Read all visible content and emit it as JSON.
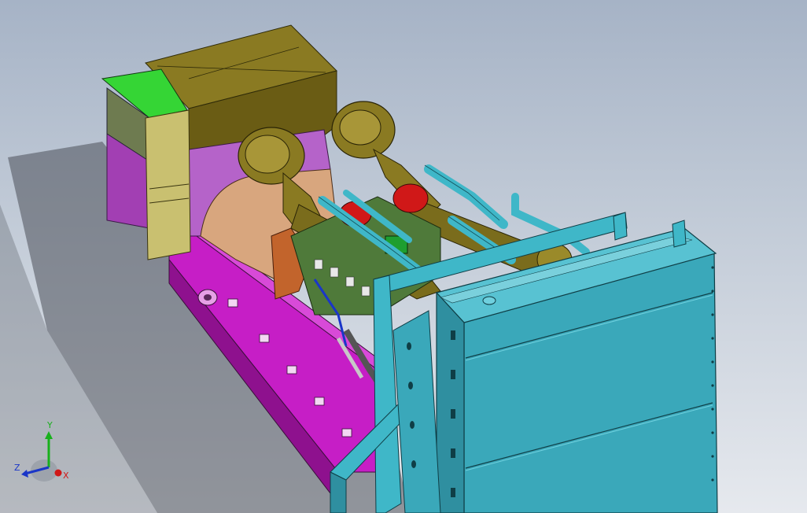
{
  "viewport": {
    "background_top": "#a6b3c6",
    "background_bottom": "#e6e9ee"
  },
  "triad": {
    "x_label": "X",
    "y_label": "Y",
    "z_label": "Z",
    "x_color": "#d01818",
    "y_color": "#18b01c",
    "z_color": "#1a36c8"
  }
}
